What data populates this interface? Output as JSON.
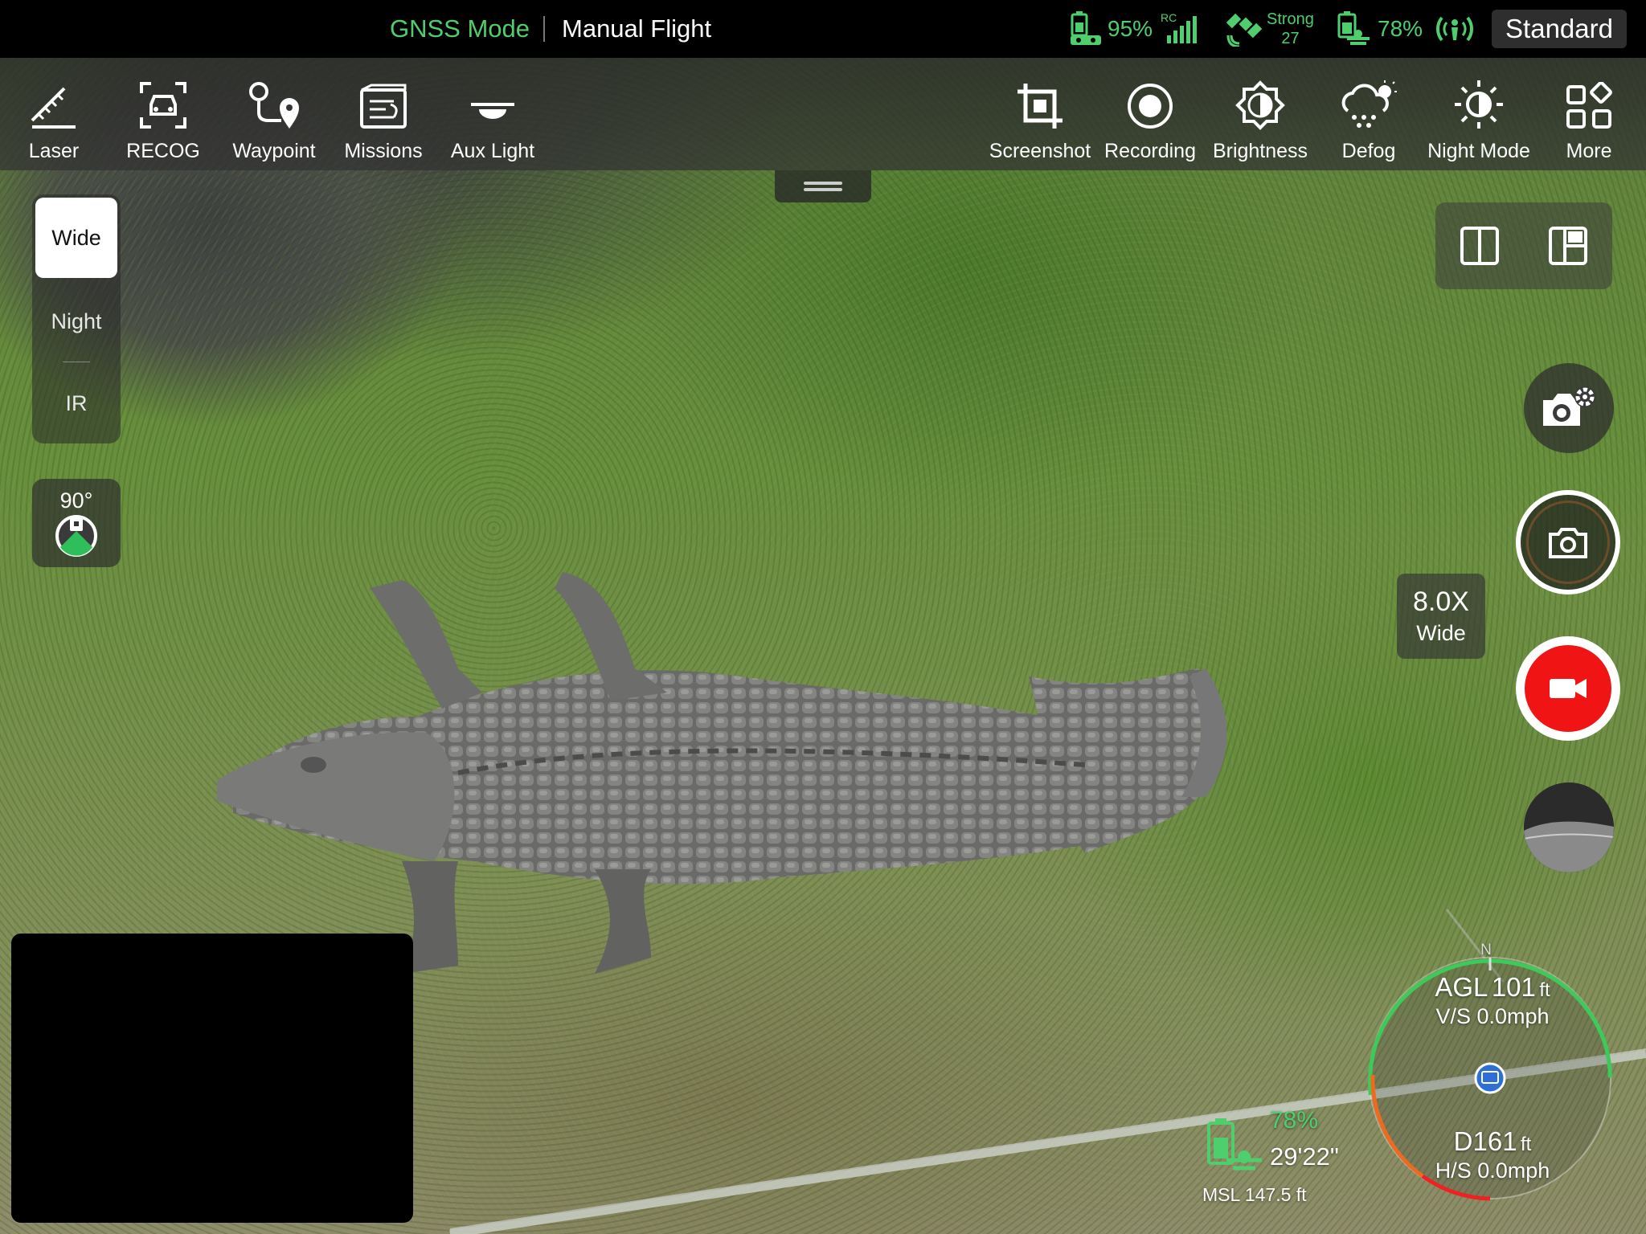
{
  "status_bar": {
    "positioning_mode": "GNSS Mode",
    "flight_mode": "Manual Flight",
    "rc_battery": "95%",
    "rc_label": "RC",
    "gps_strength": "Strong",
    "gps_satellites": "27",
    "aircraft_battery": "78%",
    "profile": "Standard",
    "accent_color": "#4fce6e"
  },
  "toolbar": {
    "left_tools": [
      {
        "label": "Laser",
        "icon": "laser-rangefinder-icon"
      },
      {
        "label": "RECOG",
        "icon": "vehicle-recognition-icon"
      },
      {
        "label": "Waypoint",
        "icon": "waypoint-icon"
      },
      {
        "label": "Missions",
        "icon": "missions-icon"
      },
      {
        "label": "Aux Light",
        "icon": "aux-light-icon"
      }
    ],
    "right_tools": [
      {
        "label": "Screenshot",
        "icon": "crop-screenshot-icon"
      },
      {
        "label": "Recording",
        "icon": "record-circle-icon"
      },
      {
        "label": "Brightness",
        "icon": "brightness-icon"
      },
      {
        "label": "Defog",
        "icon": "defog-icon"
      },
      {
        "label": "Night Mode",
        "icon": "night-mode-icon"
      },
      {
        "label": "More",
        "icon": "grid-more-icon"
      }
    ]
  },
  "lens_selector": {
    "options": [
      "Wide",
      "Night",
      "IR"
    ],
    "selected": "Wide"
  },
  "gimbal": {
    "pitch": "90°"
  },
  "zoom": {
    "level": "8.0X",
    "lens": "Wide"
  },
  "telemetry": {
    "battery_percent": "78%",
    "flight_time_remaining": "29'22\"",
    "msl": "MSL 147.5 ft",
    "agl_label": "AGL",
    "agl_value": "101",
    "agl_unit": "ft",
    "vertical_speed": "V/S 0.0mph",
    "distance_label": "D",
    "distance_value": "161",
    "distance_unit": "ft",
    "horizontal_speed": "H/S 0.0mph",
    "compass_north": "N"
  },
  "colors": {
    "record_red": "#f01414",
    "status_green": "#4fce6e",
    "warning_orange": "#f06a1e"
  }
}
